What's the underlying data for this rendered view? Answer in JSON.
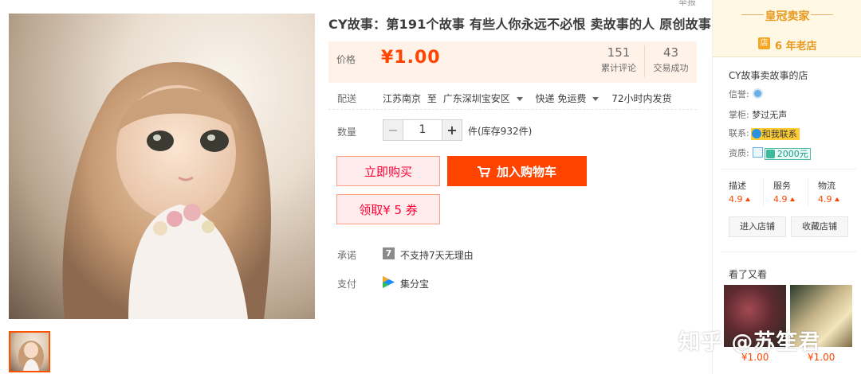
{
  "header": {
    "corner_text": "举报"
  },
  "product": {
    "title": "CY故事：第191个故事 有些人你永远不必恨 卖故事的人 原创故事",
    "price_label": "价格",
    "price": "¥1.00",
    "stats": [
      {
        "value": "151",
        "label": "累计评论"
      },
      {
        "value": "43",
        "label": "交易成功"
      }
    ],
    "shipping": {
      "label": "配送",
      "from": "江苏南京",
      "to_word": "至",
      "to": "广东深圳宝安区",
      "method": "快递 免运费",
      "dispatch": "72小时内发货"
    },
    "quantity": {
      "label": "数量",
      "minus": "−",
      "value": "1",
      "plus": "+",
      "stock_text": "件(库存932件)"
    },
    "buttons": {
      "buy_now": "立即购买",
      "add_to_cart": "加入购物车",
      "coupon": "领取¥ 5 券"
    },
    "promise": {
      "label": "承诺",
      "icon_text": "7",
      "text": "不支持7天无理由"
    },
    "payment": {
      "label": "支付",
      "text": "集分宝"
    }
  },
  "seller": {
    "badge_title": "皇冠卖家",
    "store_age_icon": "店",
    "store_age": "6 年老店",
    "shop_name": "CY故事卖故事的店",
    "credit_label": "信誉:",
    "keeper_label": "掌柜:",
    "keeper_name": "梦过无声",
    "contact_label": "联系:",
    "contact_text": "和我联系",
    "qualification_label": "资质:",
    "bond_text": "2000元",
    "ratings": [
      {
        "label": "描述",
        "value": "4.9"
      },
      {
        "label": "服务",
        "value": "4.9"
      },
      {
        "label": "物流",
        "value": "4.9"
      }
    ],
    "enter_shop": "进入店铺",
    "favorite_shop": "收藏店铺",
    "also_viewed_title": "看了又看",
    "also_viewed": [
      {
        "price": "¥1.00"
      },
      {
        "price": "¥1.00"
      }
    ]
  },
  "watermark": "知乎 @苏笙君",
  "colors": {
    "accent": "#ff4400",
    "buy_text": "#ff0036",
    "price_bg": "#fff2e8",
    "seller_gold": "#e8991f"
  },
  "icons": {
    "cart": "cart-icon",
    "caret": "chevron-down-icon",
    "pay": "alipay-points-icon",
    "credit": "credit-level-icon",
    "wangwang": "chat-icon"
  }
}
